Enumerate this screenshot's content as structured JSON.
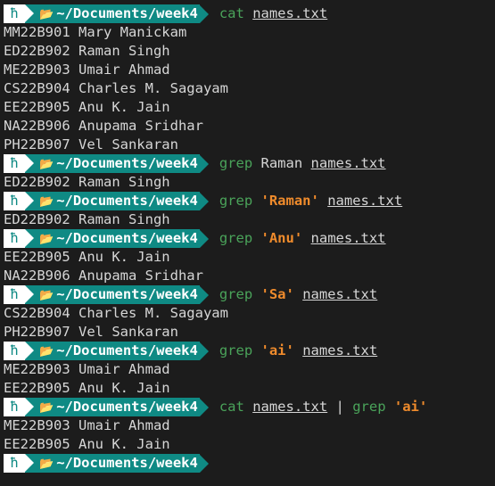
{
  "prompt": {
    "os_icon": "linux-mint-icon",
    "folder_icon": "folder-open-icon",
    "path_prefix": "~/Documents/",
    "path_tail": "week4"
  },
  "icons": {
    "os": "ħ",
    "folder": "📂"
  },
  "colors": {
    "background": "#1c1c1c",
    "prompt_teal": "#0f8a84",
    "command_green": "#4aa35a",
    "string_orange": "#ef8b2c",
    "text": "#d6d6d6"
  },
  "blocks": [
    {
      "cmd": {
        "name": "cat",
        "parts": [
          {
            "t": "file",
            "v": "names.txt"
          }
        ]
      },
      "output": [
        "MM22B901 Mary Manickam",
        "ED22B902 Raman Singh",
        "ME22B903 Umair Ahmad",
        "CS22B904 Charles M. Sagayam",
        "EE22B905 Anu K. Jain",
        "NA22B906 Anupama Sridhar",
        "PH22B907 Vel Sankaran"
      ]
    },
    {
      "cmd": {
        "name": "grep",
        "parts": [
          {
            "t": "arg",
            "v": "Raman"
          },
          {
            "t": "file",
            "v": "names.txt"
          }
        ]
      },
      "output": [
        "ED22B902 Raman Singh"
      ]
    },
    {
      "cmd": {
        "name": "grep",
        "parts": [
          {
            "t": "str",
            "v": "'Raman'"
          },
          {
            "t": "file",
            "v": "names.txt"
          }
        ]
      },
      "output": [
        "ED22B902 Raman Singh"
      ]
    },
    {
      "cmd": {
        "name": "grep",
        "parts": [
          {
            "t": "str",
            "v": "'Anu'"
          },
          {
            "t": "file",
            "v": "names.txt"
          }
        ]
      },
      "output": [
        "EE22B905 Anu K. Jain",
        "NA22B906 Anupama Sridhar"
      ]
    },
    {
      "cmd": {
        "name": "grep",
        "parts": [
          {
            "t": "str",
            "v": "'Sa'"
          },
          {
            "t": "file",
            "v": "names.txt"
          }
        ]
      },
      "output": [
        "CS22B904 Charles M. Sagayam",
        "PH22B907 Vel Sankaran"
      ]
    },
    {
      "cmd": {
        "name": "grep",
        "parts": [
          {
            "t": "str",
            "v": "'ai'"
          },
          {
            "t": "file",
            "v": "names.txt"
          }
        ]
      },
      "output": [
        "ME22B903 Umair Ahmad",
        "EE22B905 Anu K. Jain"
      ]
    },
    {
      "cmd": {
        "name": "cat",
        "parts": [
          {
            "t": "file",
            "v": "names.txt"
          },
          {
            "t": "pipe",
            "v": "|"
          },
          {
            "t": "cmd",
            "v": "grep"
          },
          {
            "t": "str",
            "v": "'ai'"
          }
        ]
      },
      "output": [
        "ME22B903 Umair Ahmad",
        "EE22B905 Anu K. Jain"
      ]
    },
    {
      "cmd": null,
      "output": []
    }
  ]
}
